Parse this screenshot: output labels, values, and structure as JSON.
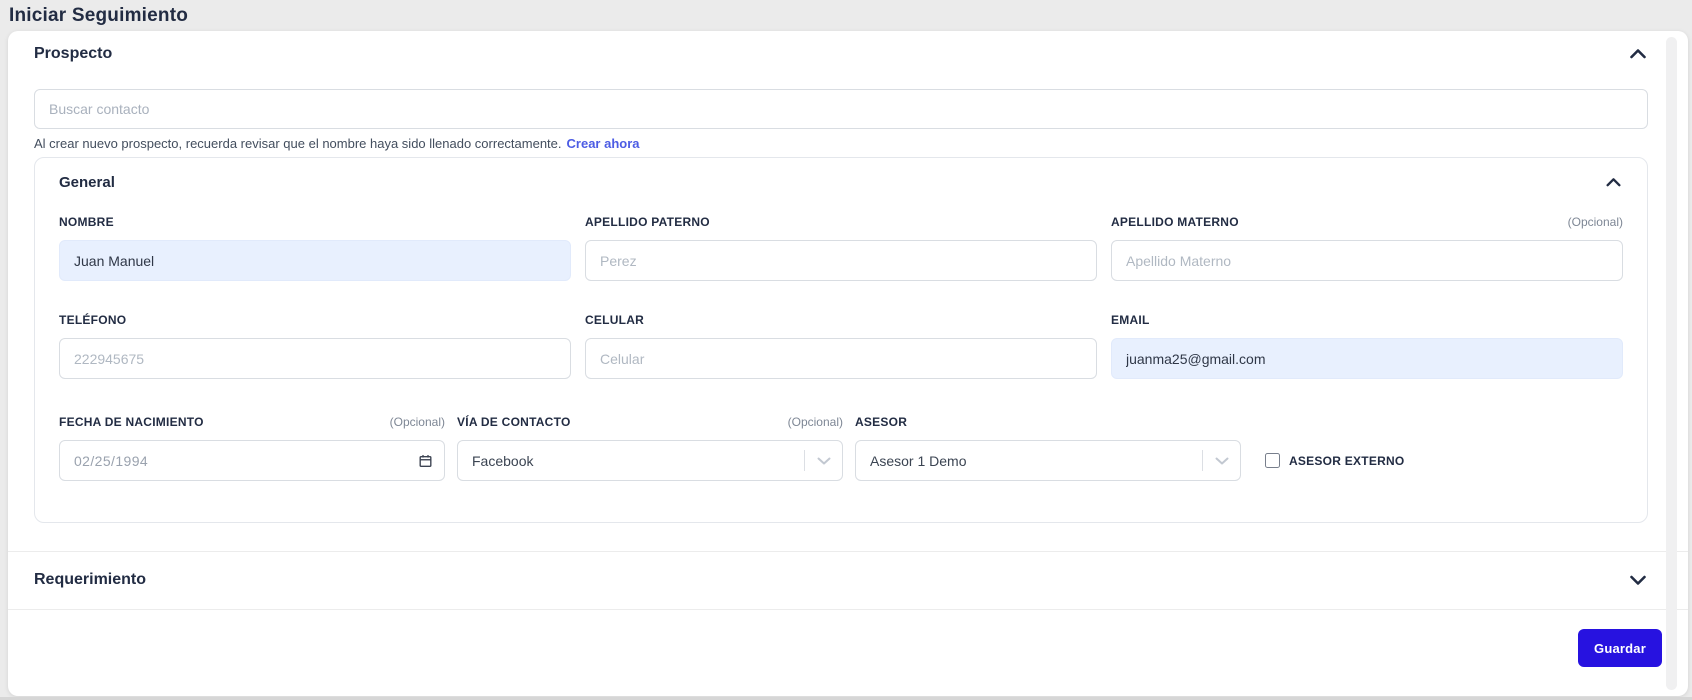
{
  "page": {
    "title": "Iniciar Seguimiento"
  },
  "prospecto": {
    "heading": "Prospecto",
    "search_placeholder": "Buscar contacto",
    "hint_text": "Al crear nuevo prospecto, recuerda revisar que el nombre haya sido llenado correctamente.",
    "hint_link": "Crear ahora"
  },
  "general": {
    "heading": "General",
    "fields": {
      "nombre": {
        "label": "NOMBRE",
        "value": "Juan Manuel"
      },
      "apellido_paterno": {
        "label": "APELLIDO PATERNO",
        "placeholder": "Perez"
      },
      "apellido_materno": {
        "label": "APELLIDO MATERNO",
        "optional": "(Opcional)",
        "placeholder": "Apellido Materno"
      },
      "telefono": {
        "label": "TELÉFONO",
        "placeholder": "222945675"
      },
      "celular": {
        "label": "CELULAR",
        "placeholder": "Celular"
      },
      "email": {
        "label": "EMAIL",
        "value": "juanma25@gmail.com"
      },
      "fecha_nacimiento": {
        "label": "FECHA DE NACIMIENTO",
        "optional": "(Opcional)",
        "value": "02/25/1994"
      },
      "via_contacto": {
        "label": "VÍA DE CONTACTO",
        "optional": "(Opcional)",
        "value": "Facebook"
      },
      "asesor": {
        "label": "ASESOR",
        "value": "Asesor 1 Demo"
      },
      "asesor_externo": {
        "label": "ASESOR EXTERNO",
        "checked": false
      }
    }
  },
  "requerimiento": {
    "heading": "Requerimiento"
  },
  "footer": {
    "save_label": "Guardar"
  },
  "icons": {
    "prospecto_chevron": "chevron-up",
    "general_chevron": "chevron-up",
    "requerimiento_chevron": "chevron-down",
    "date_icon": "calendar",
    "select_arrow": "chevron-down"
  },
  "colors": {
    "primary_button": "#2712e0",
    "link": "#4c5ce4",
    "autofill_background": "#e8f0fe",
    "heading_text": "#222c43",
    "page_background": "#ebebeb"
  }
}
